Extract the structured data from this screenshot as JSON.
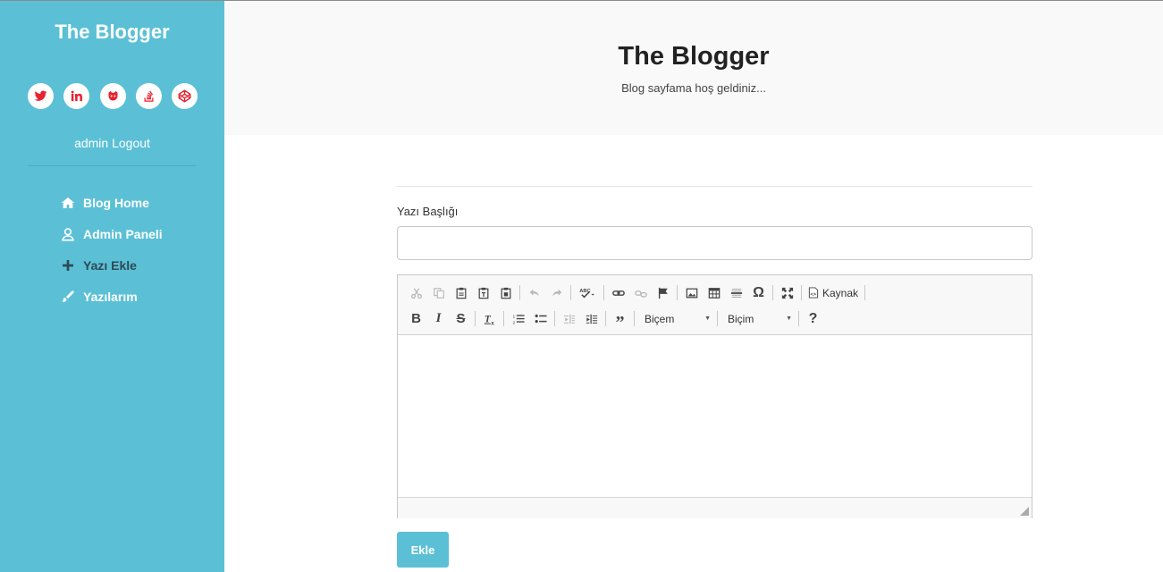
{
  "sidebar": {
    "brand": "The Blogger",
    "social_icons": [
      "twitter-icon",
      "linkedin-icon",
      "github-icon",
      "stackoverflow-icon",
      "codepen-icon"
    ],
    "social_icon_color": "#e8222f",
    "user": "admin",
    "logout": "Logout",
    "nav": [
      {
        "label": "Blog Home",
        "icon": "home-icon"
      },
      {
        "label": "Admin Paneli",
        "icon": "user-icon"
      },
      {
        "label": "Yazı Ekle",
        "icon": "plus-icon"
      },
      {
        "label": "Yazılarım",
        "icon": "pencil-icon"
      }
    ],
    "bg_color": "#5bc0d6",
    "active_color": "#2d4a55"
  },
  "header": {
    "title": "The Blogger",
    "subtitle": "Blog sayfama hoş geldiniz..."
  },
  "form": {
    "title_label": "Yazı Başlığı",
    "title_value": "",
    "editor": {
      "source_label": "Kaynak",
      "styles_combo": "Biçem",
      "format_combo": "Biçim",
      "content": ""
    },
    "submit_label": "Ekle"
  }
}
